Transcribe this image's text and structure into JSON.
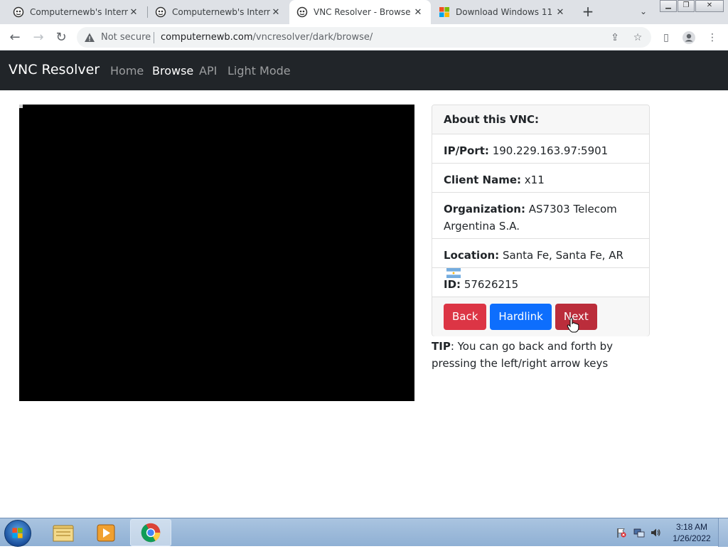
{
  "browser": {
    "tabs": [
      {
        "title": "Computernewb's Internet",
        "icon": "vnc-globe-icon",
        "active": false
      },
      {
        "title": "Computernewb's Internet",
        "icon": "vnc-globe-icon",
        "active": false
      },
      {
        "title": "VNC Resolver - Browse",
        "icon": "vnc-globe-icon",
        "active": true
      },
      {
        "title": "Download Windows 11",
        "icon": "microsoft-logo-icon",
        "active": false
      }
    ],
    "security_label": "Not secure",
    "url_host": "computernewb.com",
    "url_path": "/vncresolver/dark/browse/"
  },
  "site": {
    "brand": "VNC Resolver",
    "nav": [
      "Home",
      "Browse",
      "API",
      "Light Mode"
    ],
    "active_nav": "Browse"
  },
  "vnc_info": {
    "header": "About this VNC:",
    "ip_label": "IP/Port:",
    "ip_value": "190.229.163.97:5901",
    "client_label": "Client Name:",
    "client_value": "x11",
    "org_label": "Organization:",
    "org_value": "AS7303 Telecom Argentina S.A.",
    "location_label": "Location:",
    "location_value": "Santa Fe, Santa Fe, AR",
    "id_label": "ID:",
    "id_value": "57626215"
  },
  "buttons": {
    "back": "Back",
    "hardlink": "Hardlink",
    "next": "Next"
  },
  "tip": {
    "label": "TIP",
    "text": ": You can go back and forth by pressing the left/right arrow keys"
  },
  "taskbar": {
    "time": "3:18 AM",
    "date": "1/26/2022"
  },
  "colors": {
    "navbar_bg": "#212529",
    "btn_danger": "#dc3545",
    "btn_primary": "#0d6efd",
    "btn_next_hover": "#bb2d3b"
  }
}
